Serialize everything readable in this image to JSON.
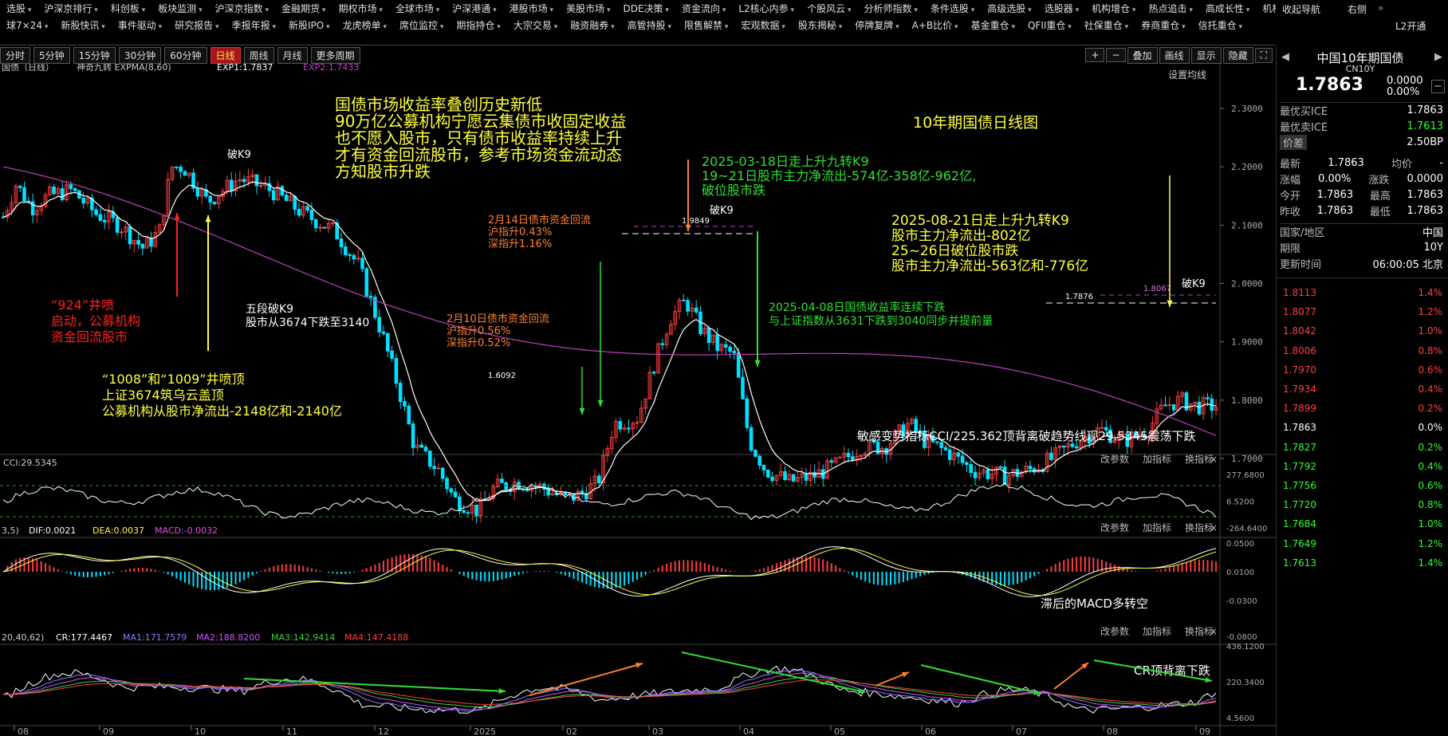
{
  "nav_top": [
    "选股",
    "沪深京排行",
    "科创板",
    "板块监测",
    "沪深京指数",
    "金融期货",
    "期权市场",
    "全球市场",
    "沪深港通",
    "港股市场",
    "美股市场",
    "DDE决策",
    "资金流向",
    "L2核心内参",
    "个股风云",
    "分析师指数",
    "条件选股",
    "高级选股",
    "选股器",
    "机构增仓",
    "热点追击",
    "高成长性",
    "机构推荐"
  ],
  "nav_bottom": [
    "球7×24",
    "新股快讯",
    "事件驱动",
    "研究报告",
    "季报年报",
    "新股IPO",
    "龙虎榜单",
    "席位监控",
    "期指持仓",
    "大宗交易",
    "融资融券",
    "高管持股",
    "限售解禁",
    "宏观数据",
    "股东揭秘",
    "停牌复牌",
    "A+B比价",
    "基金重仓",
    "QFII重仓",
    "社保重仓",
    "券商重仓",
    "信托重仓"
  ],
  "nav_right": {
    "guide": "收起导航",
    "right": "右侧",
    "l2": "L2开通"
  },
  "periods": [
    "分时",
    "5分钟",
    "15分钟",
    "30分钟",
    "60分钟",
    "日线",
    "周线",
    "月线",
    "更多周期"
  ],
  "period_selected": "日线",
  "toolbar_right": [
    "+",
    "−",
    "叠加",
    "画线",
    "显示",
    "隐藏",
    "⛶"
  ],
  "main_legend": {
    "name": "国债（日线）",
    "indicator": "神奇九转 EXPMA(8,60)",
    "exp1": "EXP1:1.7837",
    "exp2": "EXP2:1.7433",
    "setting": "设置均线"
  },
  "chart_title": "10年期国债日线图",
  "annotations": {
    "a1": [
      "国债市场收益率叠创历史新低",
      "90万亿公募机构宁愿云集债市收固定收益",
      "也不愿入股市，只有债市收益率持续上升",
      "才有资金回流股市，参考市场资金流动态",
      "方知股市升跌"
    ],
    "a2": [
      "2025-03-18日走上升九转K9",
      "19~21日股市主力净流出-574亿-358亿-962亿,",
      "破位股市跌"
    ],
    "a3": [
      "2025-08-21日走上升九转K9",
      "股市主力净流出-802亿",
      "25~26日破位股市跌",
      "股市主力净流出-563亿和-776亿"
    ],
    "a4": [
      "2月14日债市资金回流",
      "沪指升0.43%",
      "深指升1.16%"
    ],
    "a5": [
      "2月10日债市资金回流",
      "沪指升0.56%",
      "深指升0.52%"
    ],
    "a6": [
      "五段破K9",
      "股市从3674下跌至3140"
    ],
    "a7": [
      "“924”井喷",
      "启动，公募机构",
      "资金回流股市"
    ],
    "a8": [
      "“1008”和“1009”井喷顶",
      "上证3674筑乌云盖顶",
      "公募机构从股市净流出-2148亿和-2140亿"
    ],
    "a9": [
      "2025-04-08日国债收益率连续下跌",
      "与上证指数从3631下跌到3040同步并提前量"
    ],
    "a10": "敏感变势指标CCI/225.362顶背离破趋势线现29.5345震荡下跌",
    "a11": "滞后的MACD多转空",
    "a12": "CR顶背离下跌",
    "pok9": "破K9",
    "v1": "1.6092",
    "v2": "1.9849",
    "v3": "1.7876",
    "v4": "1.8067"
  },
  "y_axis_main": [
    "2.3000",
    "2.2000",
    "2.1000",
    "2.0000",
    "1.9000",
    "1.8000",
    "1.7000"
  ],
  "x_axis": [
    "08",
    "09",
    "10",
    "11",
    "12",
    "2025",
    "02",
    "03",
    "04",
    "05",
    "06",
    "07",
    "08",
    "09"
  ],
  "cci": {
    "label": "CCI:29.5345",
    "ticks": [
      "277.6800",
      "6.5200",
      "-264.6400"
    ]
  },
  "macd": {
    "label_params": "3,5)",
    "dif": "DIF:0.0021",
    "dea": "DEA:0.0037",
    "macd": "MACD:-0.0032",
    "ticks": [
      "0.0500",
      "0.0100",
      "-0.0300",
      "-0.0800"
    ]
  },
  "cr": {
    "label_params": "20,40,62)",
    "cr": "CR:177.4467",
    "ma1": "MA1:171.7579",
    "ma2": "MA2:188.8200",
    "ma3": "MA3:142.9414",
    "ma4": "MA4:147.4188",
    "ticks": [
      "436.1200",
      "220.3400",
      "4.5600"
    ]
  },
  "pane_buttons": [
    "改参数",
    "加指标",
    "换指标",
    "×"
  ],
  "panel": {
    "title": "中国10年期国债",
    "code": "CN10Y",
    "price": "1.7863",
    "chg": "0.0000",
    "pct": "0.00%",
    "bid_label": "最优买ICE",
    "bid": "1.7863",
    "ask_label": "最优卖ICE",
    "ask": "1.7613",
    "spread_label": "价差",
    "spread": "2.50BP",
    "rows": [
      [
        "最新",
        "1.7863",
        "均价",
        "-"
      ],
      [
        "涨幅",
        "0.00%",
        "涨跌",
        "0.0000"
      ],
      [
        "今开",
        "1.7863",
        "最高",
        "1.7863"
      ],
      [
        "昨收",
        "1.7863",
        "最低",
        "1.7863"
      ]
    ],
    "country_label": "国家/地区",
    "country": "中国",
    "term_label": "期限",
    "term": "10Y",
    "update_label": "更新时间",
    "update": "06:00:05 北京",
    "depth": [
      [
        "1.8113",
        "1.4%"
      ],
      [
        "1.8077",
        "1.2%"
      ],
      [
        "1.8042",
        "1.0%"
      ],
      [
        "1.8006",
        "0.8%"
      ],
      [
        "1.7970",
        "0.6%"
      ],
      [
        "1.7934",
        "0.4%"
      ],
      [
        "1.7899",
        "0.2%"
      ],
      [
        "1.7863",
        "0.0%"
      ],
      [
        "1.7827",
        "0.2%"
      ],
      [
        "1.7792",
        "0.4%"
      ],
      [
        "1.7756",
        "0.6%"
      ],
      [
        "1.7720",
        "0.8%"
      ],
      [
        "1.7684",
        "1.0%"
      ],
      [
        "1.7649",
        "1.2%"
      ],
      [
        "1.7613",
        "1.4%"
      ]
    ]
  },
  "colors": {
    "up": "#ff3c3c",
    "down": "#00e0ff",
    "exp1": "#ffffff",
    "exp2": "#c040c0",
    "yellow": "#ffff40",
    "green": "#30e030",
    "orange": "#ff8030",
    "red": "#ff2020",
    "cyan_text": "#60ffff"
  }
}
